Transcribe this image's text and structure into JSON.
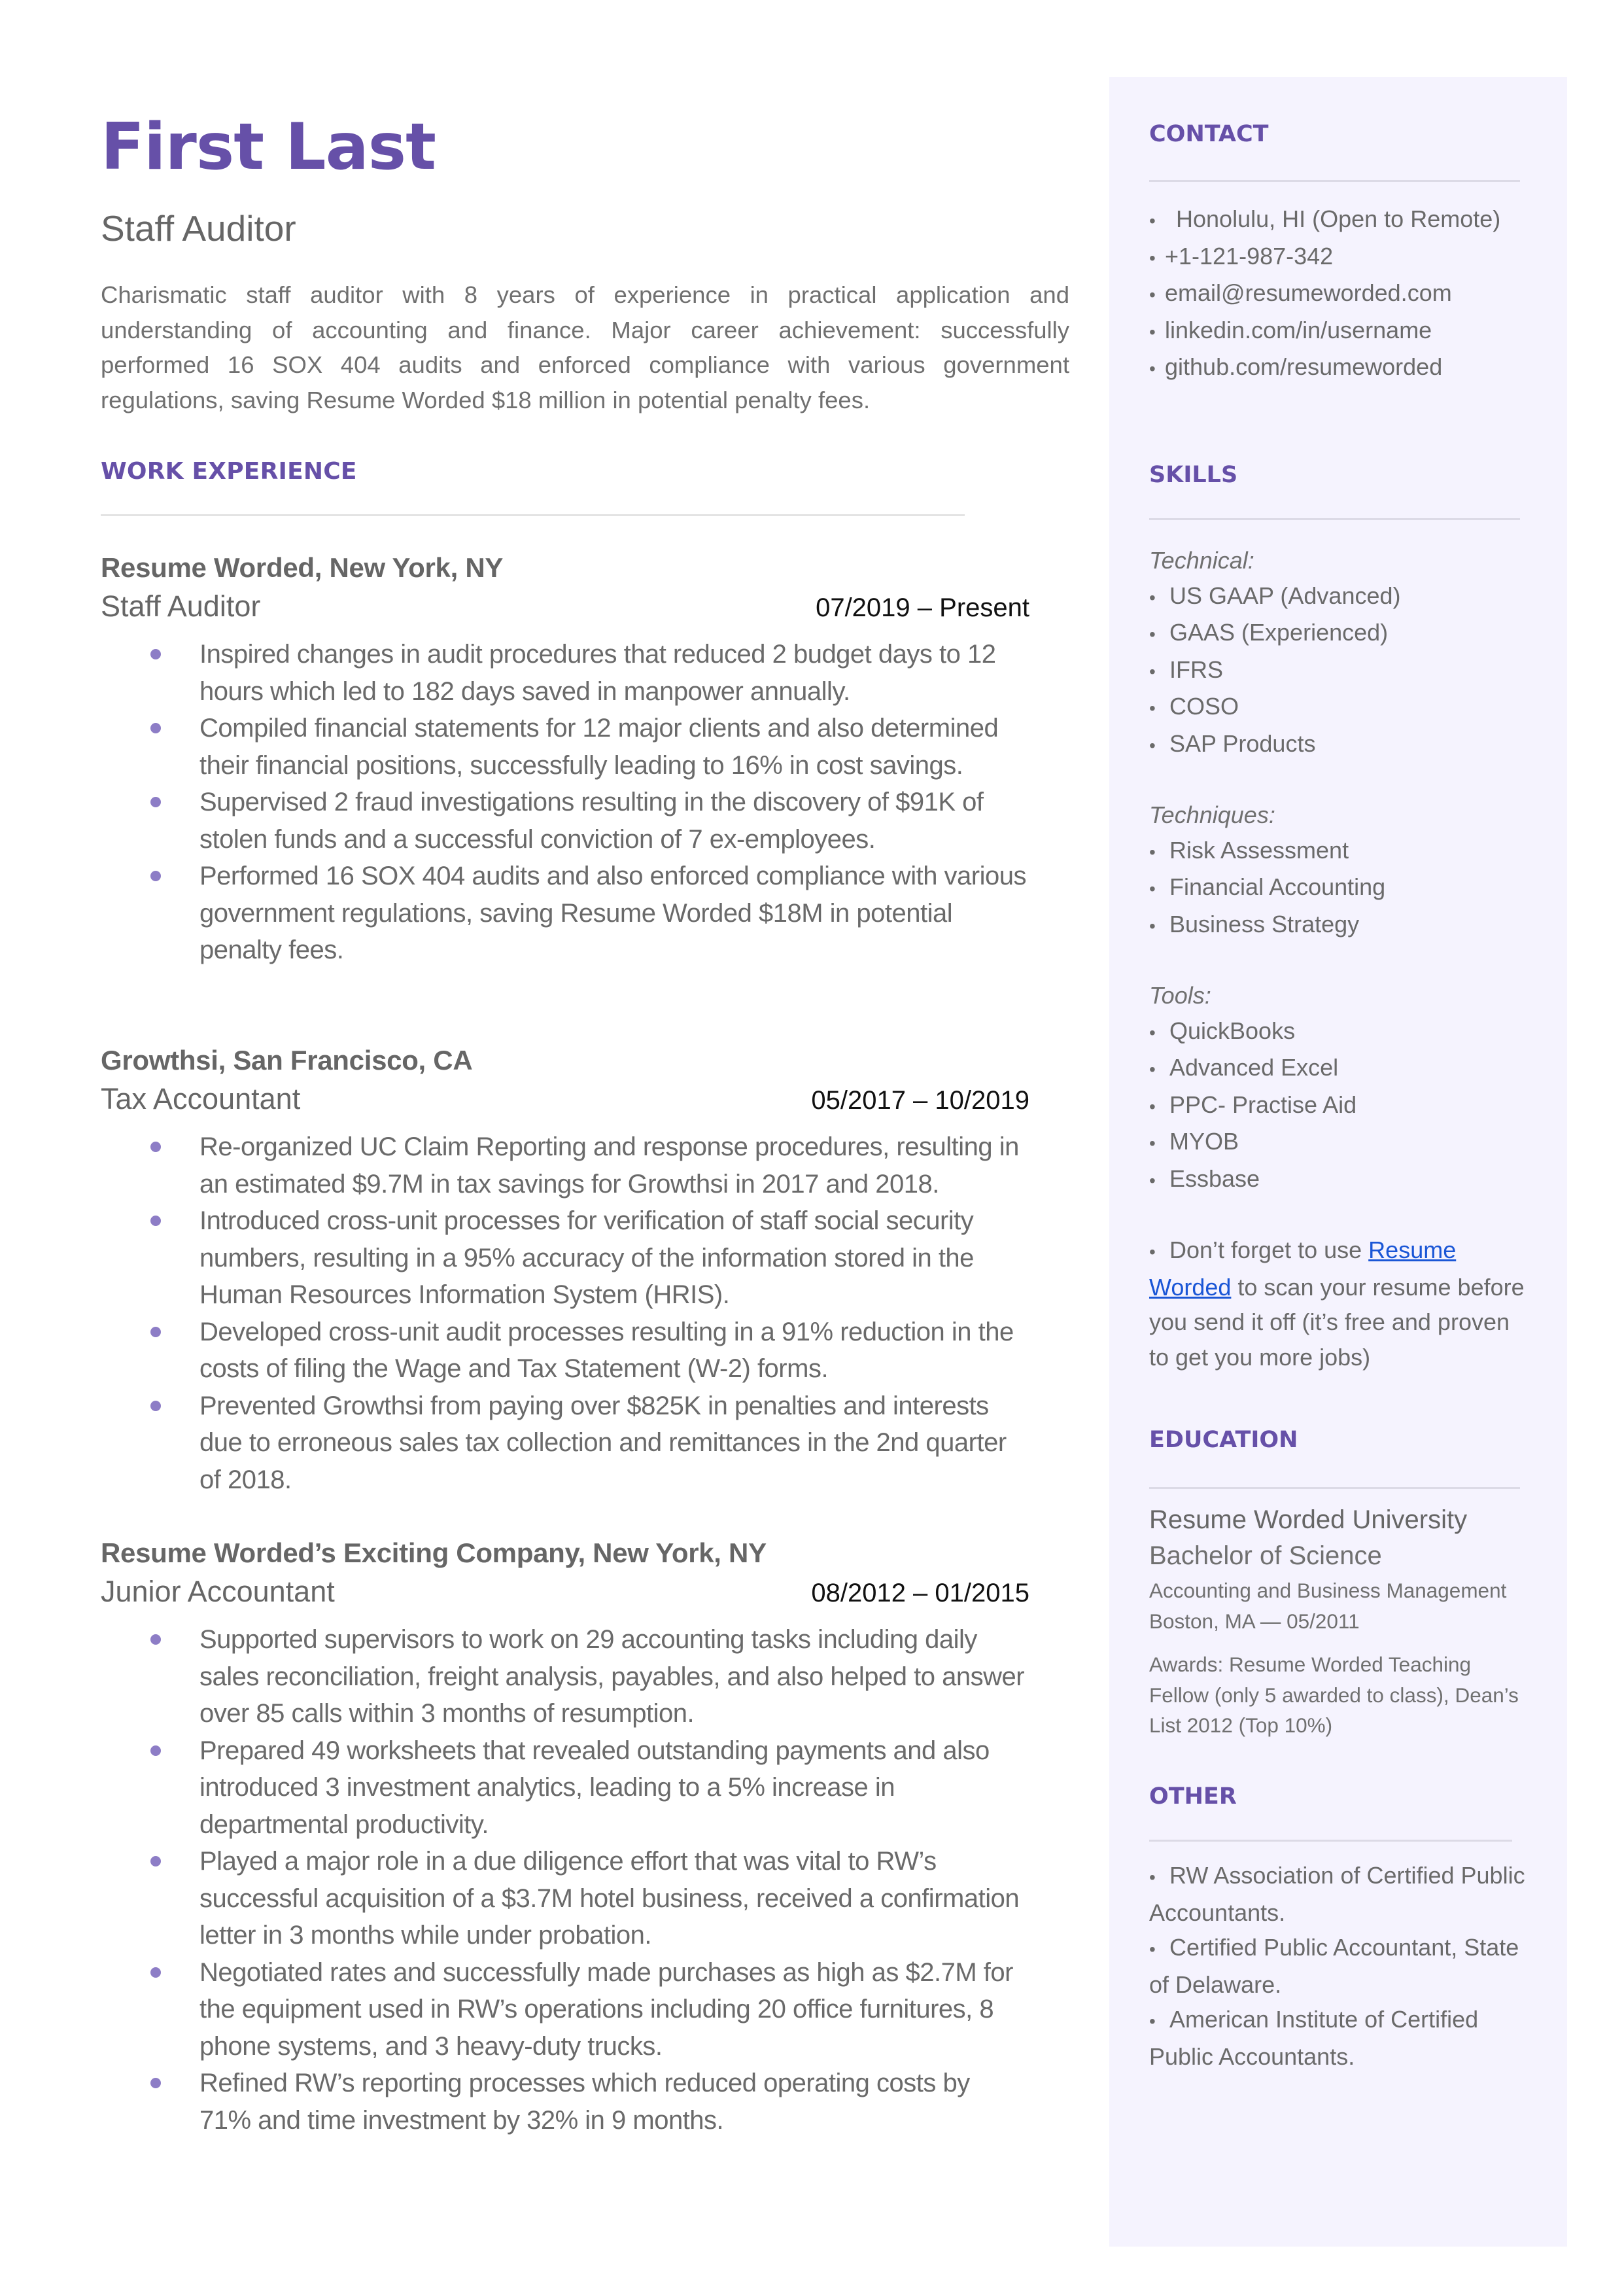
{
  "header": {
    "name": "First Last",
    "title": "Staff Auditor",
    "summary": "Charismatic staff auditor with 8 years of experience in practical application and understanding of accounting and finance. Major career achievement: successfully performed 16 SOX 404 audits and enforced compliance with various government regulations, saving Resume Worded $18 million in potential penalty fees."
  },
  "colors": {
    "accent": "#6650A8",
    "bullet": "#8D7DC6",
    "sidebar_bg": "#F5F3FE",
    "body_text": "#666666",
    "link": "#1A56D6"
  },
  "work": {
    "heading": "WORK EXPERIENCE",
    "jobs": [
      {
        "company": "Resume Worded, New York, NY",
        "role": "Staff Auditor",
        "dates": "07/2019 – Present",
        "bullets": [
          "Inspired changes in audit procedures that reduced 2 budget days to 12 hours which led to 182 days saved in manpower annually.",
          "Compiled financial statements for 12 major clients and also determined their financial positions, successfully leading to 16% in cost savings.",
          "Supervised 2 fraud investigations resulting in the discovery of $91K of stolen funds and a successful conviction of 7 ex-employees.",
          "Performed 16 SOX 404 audits and also enforced compliance with various government regulations, saving Resume Worded $18M in potential penalty fees."
        ]
      },
      {
        "company": "Growthsi, San Francisco, CA",
        "role": "Tax Accountant",
        "dates": "05/2017 – 10/2019",
        "bullets": [
          "Re-organized UC Claim Reporting and response procedures, resulting in an estimated $9.7M in tax savings for Growthsi in 2017 and 2018.",
          "Introduced cross-unit processes for verification of staff social security numbers, resulting in a 95% accuracy of the information stored in the Human Resources Information System (HRIS).",
          "Developed cross-unit audit processes resulting in a 91% reduction in the costs of filing the Wage and Tax Statement (W-2) forms.",
          "Prevented Growthsi from paying over $825K in penalties and interests due to erroneous sales tax collection and remittances in the 2nd quarter of 2018."
        ]
      },
      {
        "company": "Resume Worded’s Exciting Company, New York, NY",
        "role": "Junior Accountant",
        "dates": "08/2012 – 01/2015",
        "bullets": [
          "Supported supervisors to work on 29 accounting tasks including daily sales reconciliation, freight analysis, payables, and also helped to answer over 85 calls within 3 months of resumption.",
          "Prepared 49 worksheets that revealed outstanding payments and also introduced 3 investment analytics, leading to a 5% increase in departmental productivity.",
          "Played a major role in a due diligence effort that was vital to RW’s successful acquisition of a $3.7M hotel business, received a confirmation letter in 3 months while under probation.",
          "Negotiated rates and successfully made purchases as high as $2.7M for the equipment used in RW’s operations including 20 office furnitures, 8 phone systems, and 3 heavy-duty trucks.",
          "Refined RW’s reporting processes which reduced operating costs by 71% and time investment by 32% in 9 months."
        ]
      }
    ]
  },
  "sidebar": {
    "contact": {
      "heading": "CONTACT",
      "bullet": "•",
      "items": [
        " Honolulu, HI (Open to Remote)",
        "+1-121-987-342",
        "email@resumeworded.com",
        "linkedin.com/in/username",
        "github.com/resumeworded"
      ]
    },
    "skills": {
      "heading": "SKILLS",
      "groups": [
        {
          "label": "Technical:",
          "items": [
            "US GAAP (Advanced)",
            "GAAS (Experienced)",
            "IFRS",
            "COSO",
            "SAP Products"
          ]
        },
        {
          "label": "Techniques:",
          "items": [
            "Risk Assessment",
            "Financial Accounting",
            "Business Strategy"
          ]
        },
        {
          "label": "Tools:",
          "items": [
            "QuickBooks",
            "Advanced Excel",
            "PPC- Practise Aid",
            "MYOB",
            "Essbase"
          ]
        }
      ],
      "note": {
        "prefix": "Don’t forget to use ",
        "link_text": "Resume Worded",
        "suffix": " to scan your resume before you send it off (it’s free and proven to get you more jobs)"
      }
    },
    "education": {
      "heading": "EDUCATION",
      "school": "Resume Worded University",
      "degree": "Bachelor of Science",
      "major": "Accounting and Business Management",
      "location_date": "Boston, MA — 05/2011",
      "awards": "Awards: Resume Worded Teaching Fellow (only 5 awarded to class), Dean’s List 2012 (Top 10%)"
    },
    "other": {
      "heading": "OTHER",
      "items": [
        "RW Association of Certified Public Accountants.",
        "Certified Public Accountant, State of Delaware.",
        "American Institute of Certified Public Accountants."
      ]
    }
  }
}
